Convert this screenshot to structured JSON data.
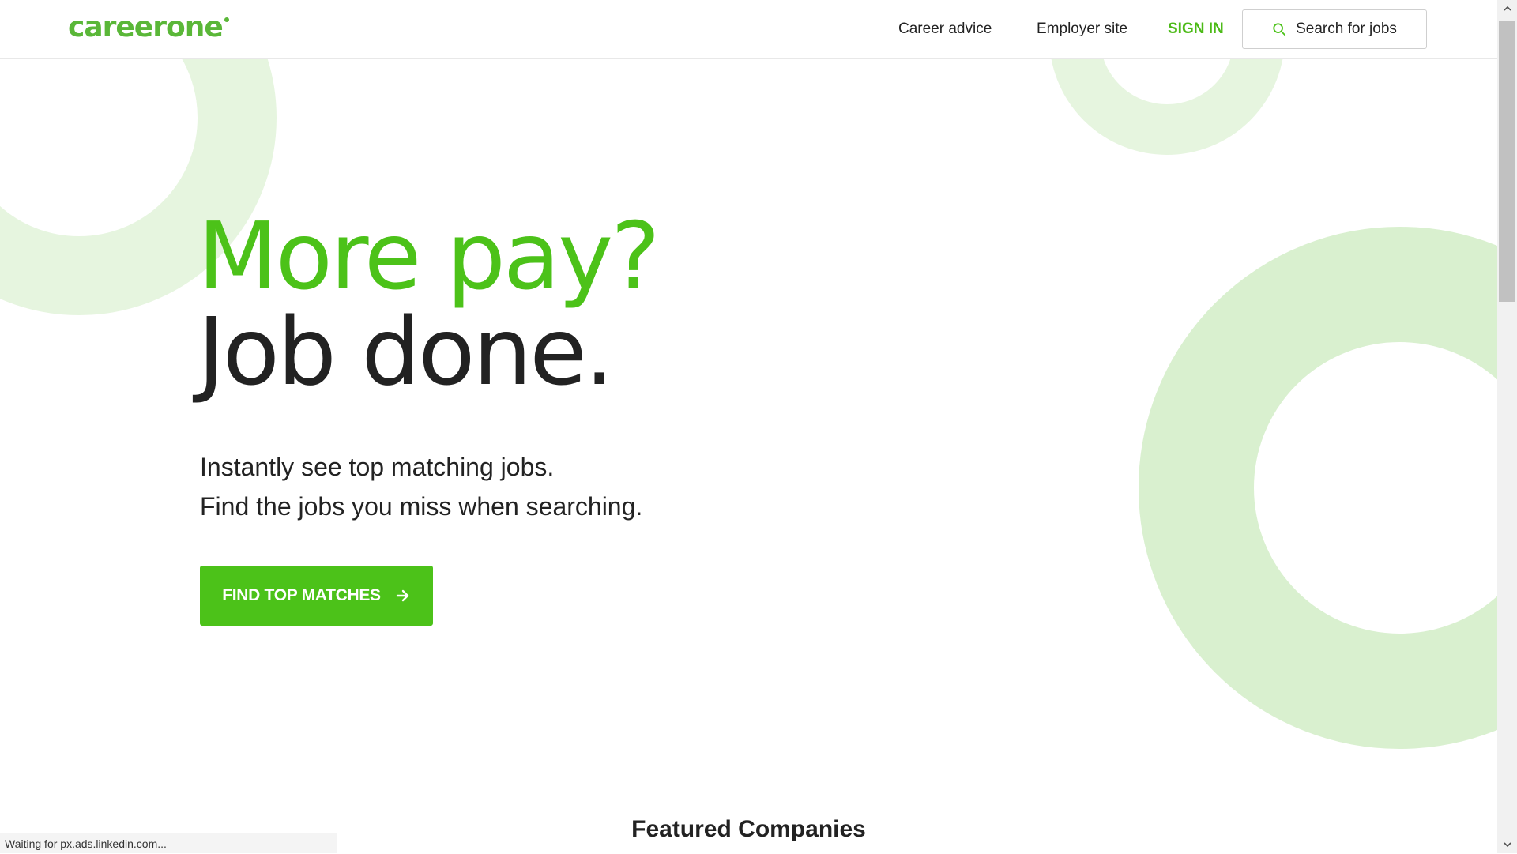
{
  "header": {
    "logo_text": "careerone",
    "nav": {
      "career_advice": "Career advice",
      "employer_site": "Employer site",
      "sign_in": "SIGN IN"
    },
    "search_button_label": "Search for jobs"
  },
  "hero": {
    "headline_line1": "More pay?",
    "headline_line2": "Job done.",
    "subtext_line1": "Instantly see top matching jobs.",
    "subtext_line2": "Find the jobs you miss when searching.",
    "cta_label": "FIND TOP MATCHES"
  },
  "featured": {
    "heading": "Featured Companies"
  },
  "status_bar": {
    "text": "Waiting for px.ads.linkedin.com..."
  },
  "icons": {
    "search": "search-icon",
    "cta_arrow": "arrow-right-icon",
    "scroll_up": "chevron-up-icon",
    "scroll_down": "chevron-down-icon"
  },
  "colors": {
    "brand_green": "#4cc219",
    "logo_green": "#5ab738",
    "ring_light": "#e6f5df",
    "ring_mid": "#d9f0cf",
    "text_dark": "#222222"
  }
}
